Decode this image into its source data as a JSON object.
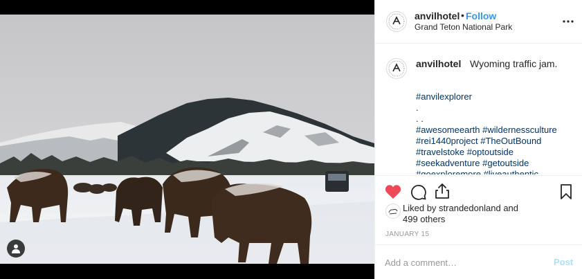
{
  "post": {
    "username": "anvilhotel",
    "separator": "•",
    "follow_label": "Follow",
    "location": "Grand Teton National Park",
    "more_icon": "more-horizontal-icon",
    "photo_alt": "Bison crossing a snowy road in Grand Teton National Park"
  },
  "caption": {
    "username": "anvilhotel",
    "text": "Wyoming traffic jam.",
    "lines": [
      "#anvilexplorer",
      ".",
      ". .",
      "#awesomeearth #wildernessculture",
      "#rei1440project #TheOutBound",
      "#travelstoke #optoutside",
      "#seekadventure #getoutside",
      "#goexploremore #liveauthentic"
    ]
  },
  "actions": {
    "like_icon": "heart-filled-icon",
    "comment_icon": "comment-icon",
    "share_icon": "share-icon",
    "save_icon": "bookmark-icon"
  },
  "likes": {
    "prefix": "Liked by",
    "user": "strandedonland",
    "mid": "and",
    "count": "499 others"
  },
  "date": "JANUARY 15",
  "comment_box": {
    "placeholder": "Add a comment…",
    "post_label": "Post"
  },
  "colors": {
    "accent": "#3897f0",
    "like": "#ed4956",
    "hashtag": "#003569",
    "post_disabled": "#b2dffc"
  }
}
